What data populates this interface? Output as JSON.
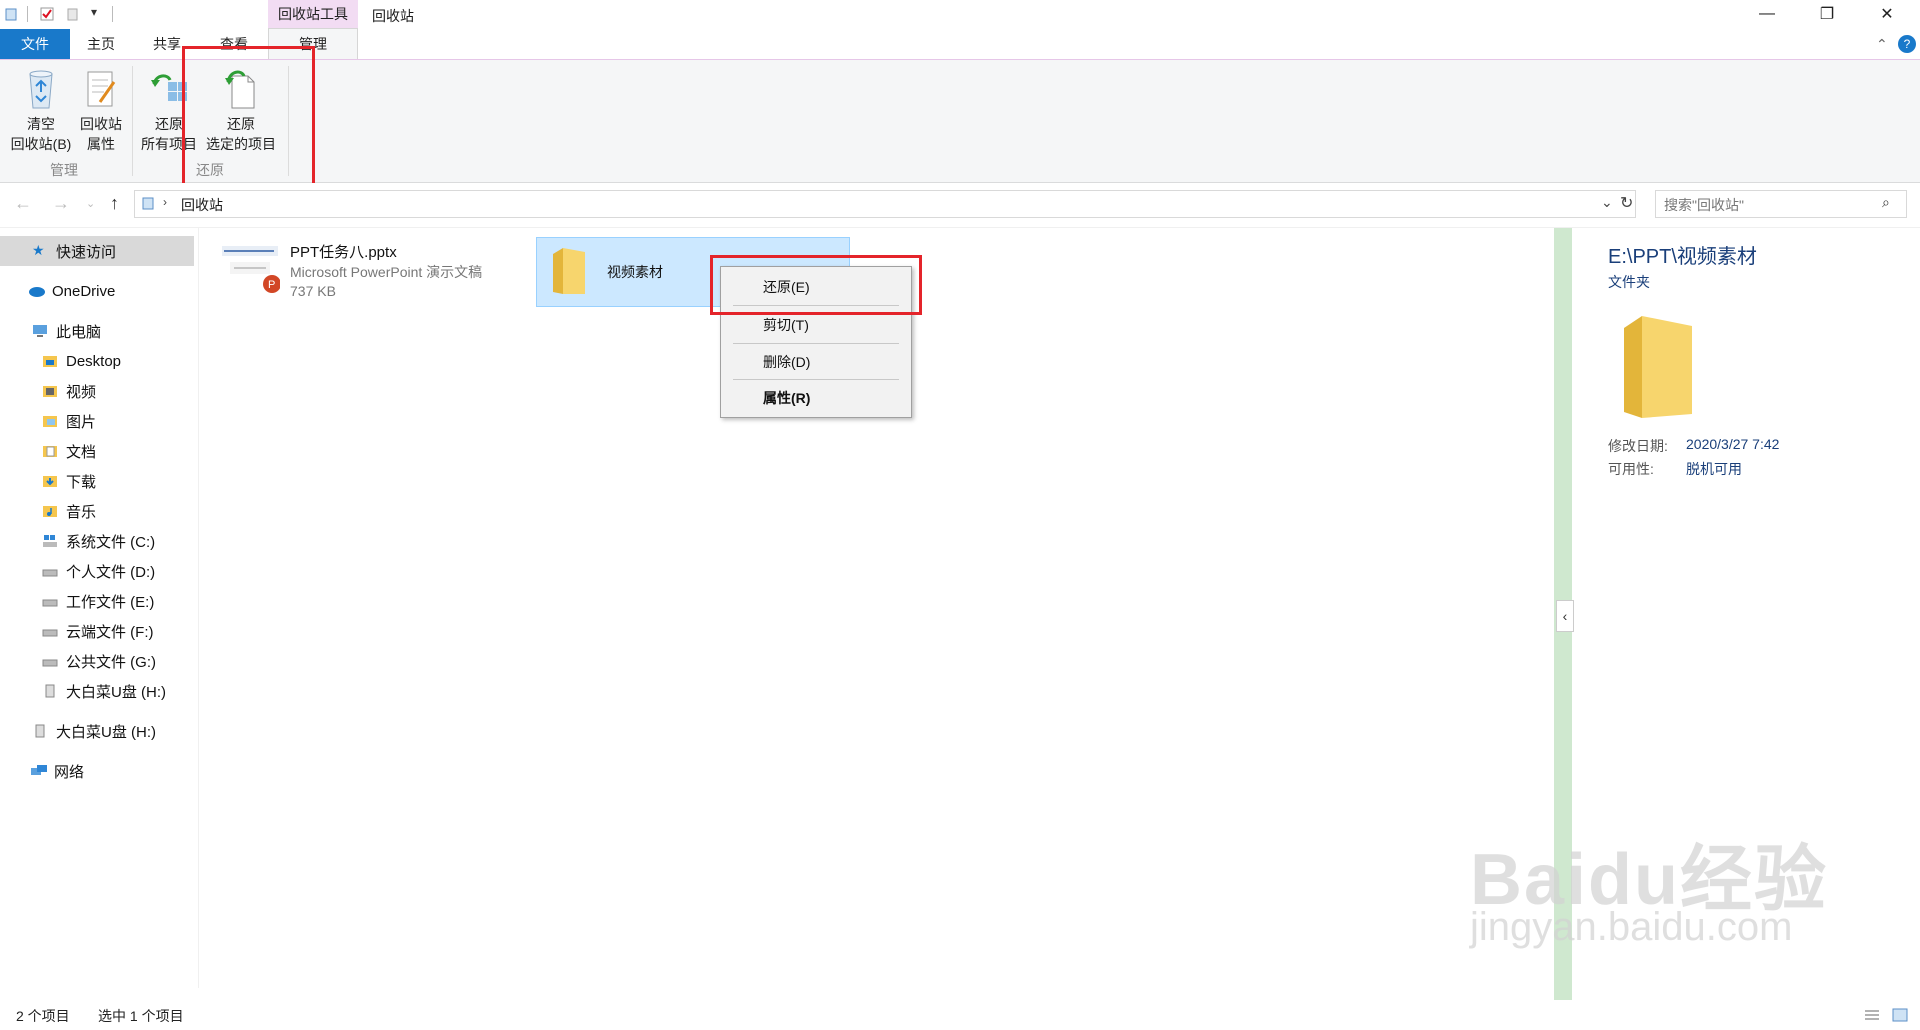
{
  "window": {
    "context_tab_header": "回收站工具",
    "title": "回收站",
    "controls": {
      "minimize": "—",
      "maximize": "❐",
      "close": "✕"
    }
  },
  "tabs": [
    {
      "label": "文件"
    },
    {
      "label": "主页"
    },
    {
      "label": "共享"
    },
    {
      "label": "查看"
    },
    {
      "label": "管理"
    }
  ],
  "ribbon": {
    "empty_bin": {
      "line1": "清空",
      "line2": "回收站(B)"
    },
    "bin_props": {
      "line1": "回收站",
      "line2": "属性"
    },
    "restore_all": {
      "line1": "还原",
      "line2": "所有项目"
    },
    "restore_selected": {
      "line1": "还原",
      "line2": "选定的项目"
    },
    "group_manage": "管理",
    "group_restore": "还原"
  },
  "address": {
    "path": "回收站",
    "search_placeholder": "搜索\"回收站\""
  },
  "sidebar": {
    "items": [
      {
        "label": "快速访问"
      },
      {
        "label": "OneDrive"
      },
      {
        "label": "此电脑"
      },
      {
        "label": "Desktop"
      },
      {
        "label": "视频"
      },
      {
        "label": "图片"
      },
      {
        "label": "文档"
      },
      {
        "label": "下载"
      },
      {
        "label": "音乐"
      },
      {
        "label": "系统文件 (C:)"
      },
      {
        "label": "个人文件 (D:)"
      },
      {
        "label": "工作文件 (E:)"
      },
      {
        "label": "云端文件 (F:)"
      },
      {
        "label": "公共文件 (G:)"
      },
      {
        "label": "大白菜U盘 (H:)"
      },
      {
        "label": "大白菜U盘 (H:)"
      },
      {
        "label": "网络"
      }
    ]
  },
  "files": [
    {
      "name": "PPT任务八.pptx",
      "type": "Microsoft PowerPoint 演示文稿",
      "size": "737 KB"
    },
    {
      "name": "视频素材"
    }
  ],
  "context_menu": {
    "restore": "还原(E)",
    "cut": "剪切(T)",
    "delete": "删除(D)",
    "properties": "属性(R)"
  },
  "details": {
    "path": "E:\\PPT\\视频素材",
    "type": "文件夹",
    "modified_label": "修改日期:",
    "modified_value": "2020/3/27 7:42",
    "availability_label": "可用性:",
    "availability_value": "脱机可用"
  },
  "status": {
    "count": "2 个项目",
    "selected": "选中 1 个项目"
  },
  "watermark": {
    "line1": "Baidu经验",
    "line2": "jingyan.baidu.com"
  },
  "colors": {
    "file_tab": "#1979ca",
    "context_header": "#f2dcf3",
    "highlight": "#e4242a",
    "selection": "#cce8ff"
  }
}
